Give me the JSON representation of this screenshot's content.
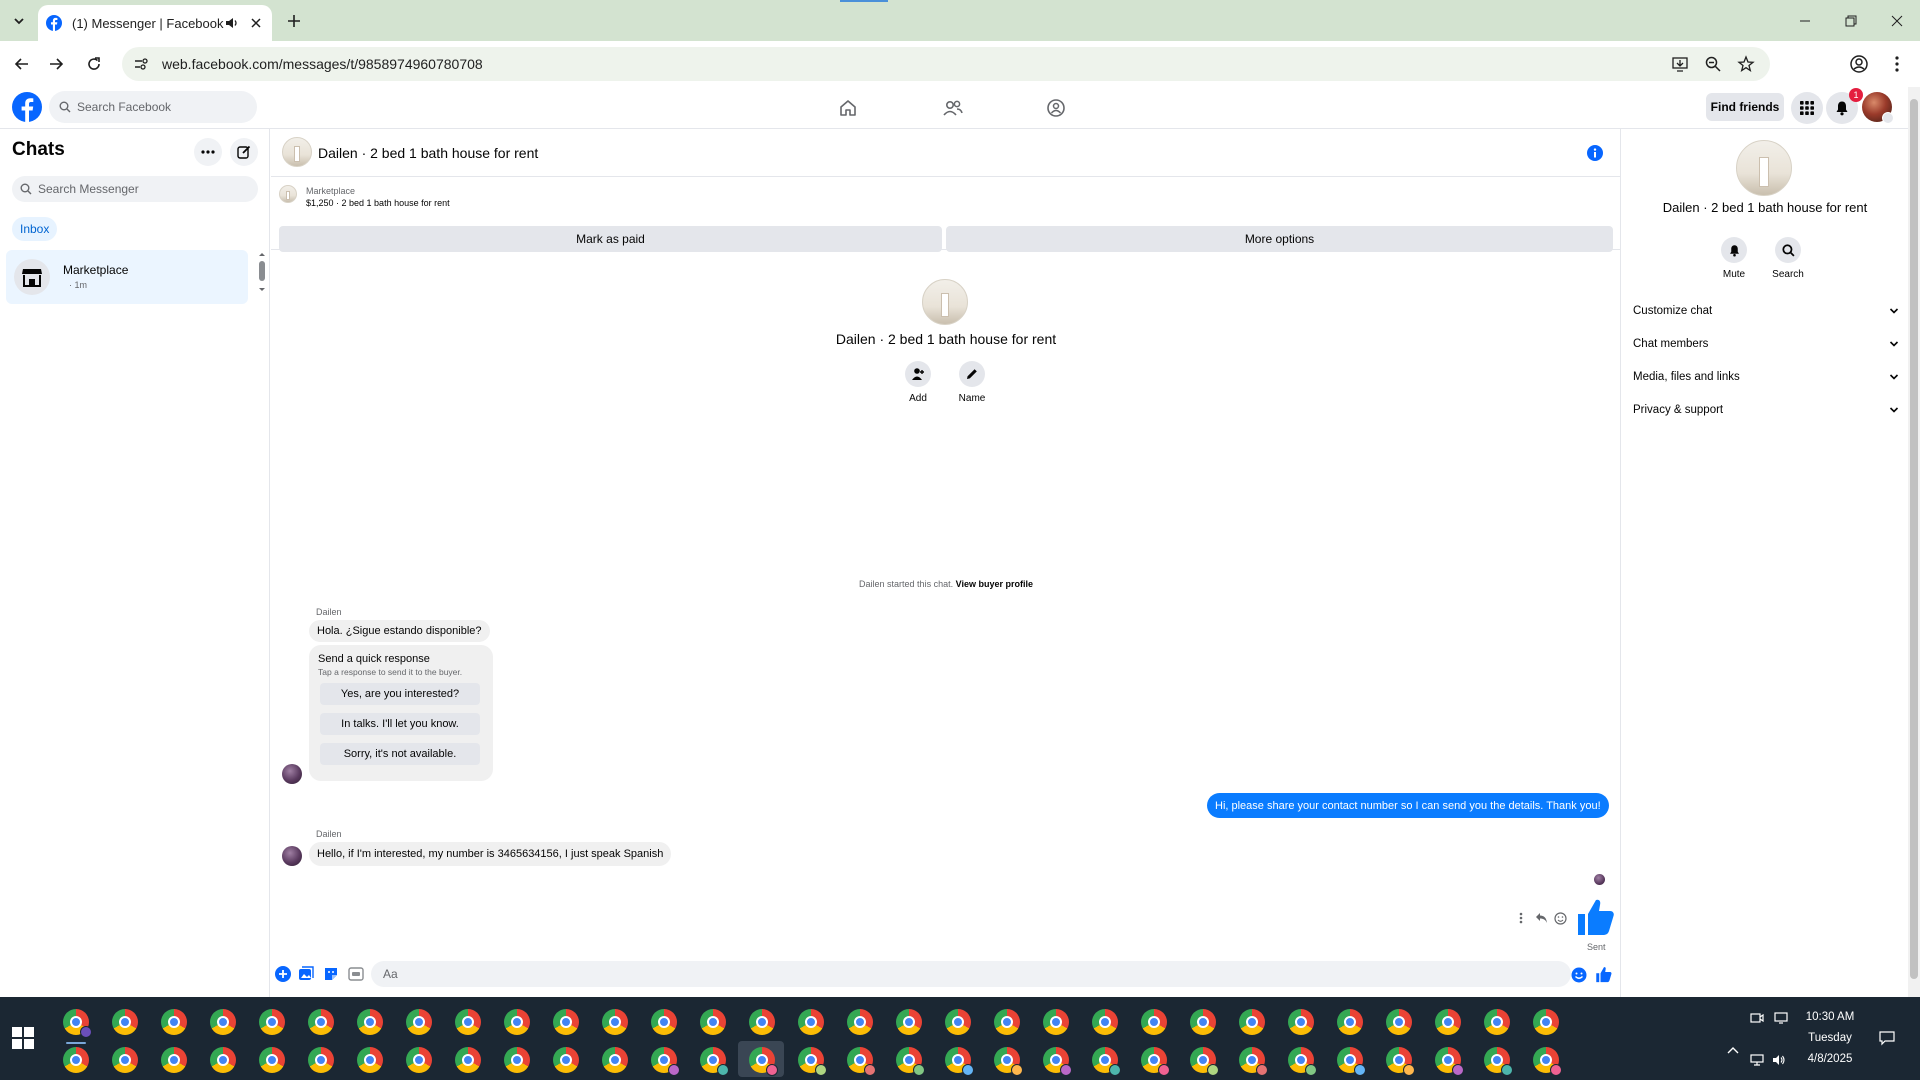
{
  "browser": {
    "tab_title": "(1) Messenger | Facebook",
    "url": "web.facebook.com/messages/t/9858974960780708"
  },
  "facebook": {
    "search_placeholder": "Search Facebook",
    "find_friends": "Find friends",
    "notification_count": "1"
  },
  "chats": {
    "title": "Chats",
    "search_placeholder": "Search Messenger",
    "filter": "Inbox",
    "items": [
      {
        "name": "Marketplace",
        "time": "· 1m"
      }
    ]
  },
  "conversation": {
    "title": "Dailen · 2 bed 1 bath house for rent",
    "marketplace_label": "Marketplace",
    "listing": "$1,250 · 2 bed 1 bath house for rent",
    "mark_paid": "Mark as paid",
    "more_options": "More options",
    "intro_name": "Dailen · 2 bed 1 bath house for rent",
    "add_label": "Add",
    "name_label": "Name",
    "started_text": "Dailen started this chat.",
    "view_buyer_profile": "View buyer profile",
    "messages": [
      {
        "sender": "Dailen",
        "text": "Hola. ¿Sigue estando disponible?"
      },
      {
        "sender": "me",
        "text": "Hi, please share your contact number so I can send you the details. Thank you!"
      },
      {
        "sender": "Dailen",
        "text": "Hello, if I'm interested, my number is 3465634156, I just speak Spanish"
      }
    ],
    "quick_response": {
      "title": "Send a quick response",
      "subtitle": "Tap a response to send it to the buyer.",
      "options": [
        "Yes, are you interested?",
        "In talks. I'll let you know.",
        "Sorry, it's not available."
      ]
    },
    "sent_label": "Sent",
    "composer_placeholder": "Aa"
  },
  "info_panel": {
    "name": "Dailen · 2 bed 1 bath house for rent",
    "mute": "Mute",
    "search": "Search",
    "sections": [
      "Customize chat",
      "Chat members",
      "Media, files and links",
      "Privacy & support"
    ]
  },
  "taskbar": {
    "time": "10:30 AM",
    "day": "Tuesday",
    "date": "4/8/2025"
  },
  "colors": {
    "facebook_blue": "#0866ff",
    "messenger_outgoing": "#0a7cff",
    "taskbar": "#1b2733",
    "tabstrip": "#d3e3d0"
  }
}
